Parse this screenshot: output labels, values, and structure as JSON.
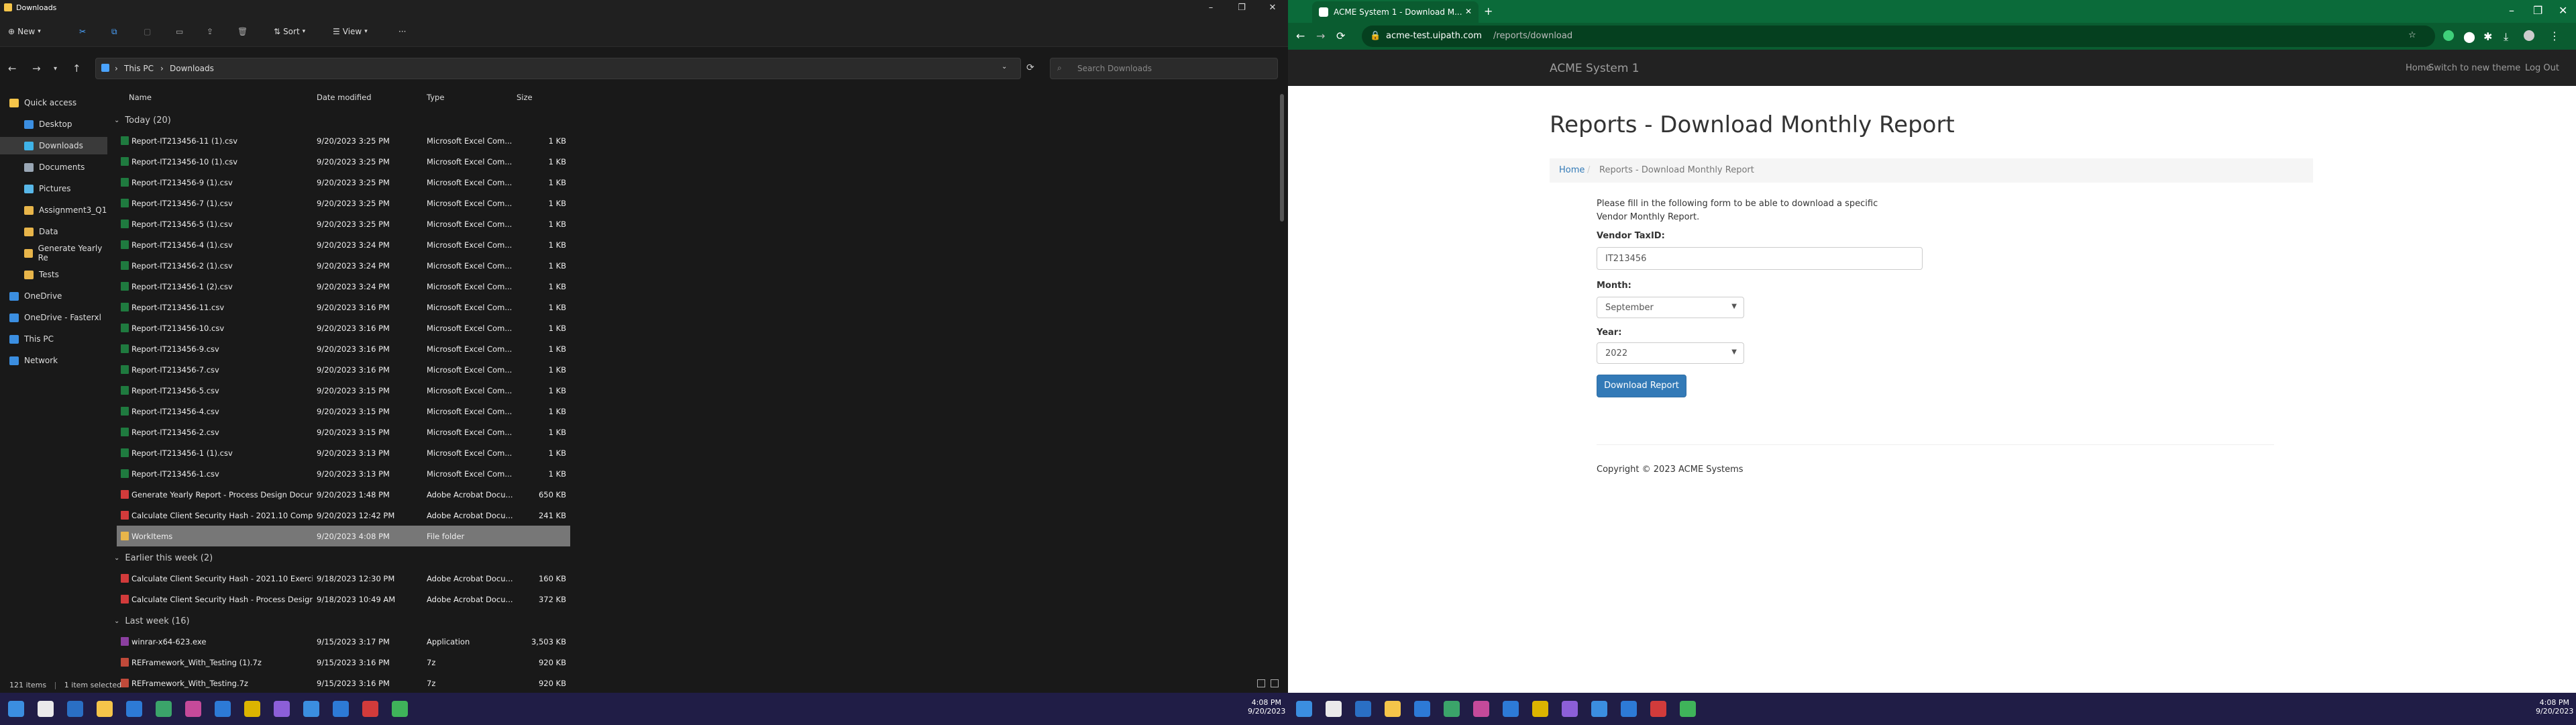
{
  "explorer": {
    "title": "Downloads",
    "cmd": {
      "new": "New",
      "sort": "Sort",
      "view": "View",
      "more": "···"
    },
    "address": {
      "root": "This PC",
      "folder": "Downloads"
    },
    "search_placeholder": "Search Downloads",
    "nav": [
      {
        "label": "Quick access",
        "color": "#f5c54a",
        "indent": 0
      },
      {
        "label": "Desktop",
        "color": "#3b8ee0",
        "indent": 1
      },
      {
        "label": "Downloads",
        "color": "#3fb3e8",
        "indent": 1,
        "selected": true
      },
      {
        "label": "Documents",
        "color": "#9aa7b5",
        "indent": 1
      },
      {
        "label": "Pictures",
        "color": "#58b7e8",
        "indent": 1
      },
      {
        "label": "Assignment3_Q1",
        "color": "#e8b54a",
        "indent": 1
      },
      {
        "label": "Data",
        "color": "#e8b54a",
        "indent": 1
      },
      {
        "label": "Generate Yearly Re",
        "color": "#e8b54a",
        "indent": 1
      },
      {
        "label": "Tests",
        "color": "#e8b54a",
        "indent": 1
      },
      {
        "label": "OneDrive",
        "color": "#3b8ee0",
        "indent": 0
      },
      {
        "label": "OneDrive - Fasterxl",
        "color": "#3b8ee0",
        "indent": 0
      },
      {
        "label": "This PC",
        "color": "#3b8ee0",
        "indent": 0
      },
      {
        "label": "Network",
        "color": "#3b8ee0",
        "indent": 0
      }
    ],
    "columns": {
      "name": "Name",
      "date": "Date modified",
      "type": "Type",
      "size": "Size"
    },
    "groups": [
      {
        "label": "Today (20)",
        "rows": [
          {
            "name": "Report-IT213456-11 (1).csv",
            "date": "9/20/2023 3:25 PM",
            "type": "Microsoft Excel Com...",
            "size": "1 KB",
            "icon": "#1f7a3f"
          },
          {
            "name": "Report-IT213456-10 (1).csv",
            "date": "9/20/2023 3:25 PM",
            "type": "Microsoft Excel Com...",
            "size": "1 KB",
            "icon": "#1f7a3f"
          },
          {
            "name": "Report-IT213456-9 (1).csv",
            "date": "9/20/2023 3:25 PM",
            "type": "Microsoft Excel Com...",
            "size": "1 KB",
            "icon": "#1f7a3f"
          },
          {
            "name": "Report-IT213456-7 (1).csv",
            "date": "9/20/2023 3:25 PM",
            "type": "Microsoft Excel Com...",
            "size": "1 KB",
            "icon": "#1f7a3f"
          },
          {
            "name": "Report-IT213456-5 (1).csv",
            "date": "9/20/2023 3:25 PM",
            "type": "Microsoft Excel Com...",
            "size": "1 KB",
            "icon": "#1f7a3f"
          },
          {
            "name": "Report-IT213456-4 (1).csv",
            "date": "9/20/2023 3:24 PM",
            "type": "Microsoft Excel Com...",
            "size": "1 KB",
            "icon": "#1f7a3f"
          },
          {
            "name": "Report-IT213456-2 (1).csv",
            "date": "9/20/2023 3:24 PM",
            "type": "Microsoft Excel Com...",
            "size": "1 KB",
            "icon": "#1f7a3f"
          },
          {
            "name": "Report-IT213456-1 (2).csv",
            "date": "9/20/2023 3:24 PM",
            "type": "Microsoft Excel Com...",
            "size": "1 KB",
            "icon": "#1f7a3f"
          },
          {
            "name": "Report-IT213456-11.csv",
            "date": "9/20/2023 3:16 PM",
            "type": "Microsoft Excel Com...",
            "size": "1 KB",
            "icon": "#1f7a3f"
          },
          {
            "name": "Report-IT213456-10.csv",
            "date": "9/20/2023 3:16 PM",
            "type": "Microsoft Excel Com...",
            "size": "1 KB",
            "icon": "#1f7a3f"
          },
          {
            "name": "Report-IT213456-9.csv",
            "date": "9/20/2023 3:16 PM",
            "type": "Microsoft Excel Com...",
            "size": "1 KB",
            "icon": "#1f7a3f"
          },
          {
            "name": "Report-IT213456-7.csv",
            "date": "9/20/2023 3:16 PM",
            "type": "Microsoft Excel Com...",
            "size": "1 KB",
            "icon": "#1f7a3f"
          },
          {
            "name": "Report-IT213456-5.csv",
            "date": "9/20/2023 3:15 PM",
            "type": "Microsoft Excel Com...",
            "size": "1 KB",
            "icon": "#1f7a3f"
          },
          {
            "name": "Report-IT213456-4.csv",
            "date": "9/20/2023 3:15 PM",
            "type": "Microsoft Excel Com...",
            "size": "1 KB",
            "icon": "#1f7a3f"
          },
          {
            "name": "Report-IT213456-2.csv",
            "date": "9/20/2023 3:15 PM",
            "type": "Microsoft Excel Com...",
            "size": "1 KB",
            "icon": "#1f7a3f"
          },
          {
            "name": "Report-IT213456-1 (1).csv",
            "date": "9/20/2023 3:13 PM",
            "type": "Microsoft Excel Com...",
            "size": "1 KB",
            "icon": "#1f7a3f"
          },
          {
            "name": "Report-IT213456-1.csv",
            "date": "9/20/2023 3:13 PM",
            "type": "Microsoft Excel Com...",
            "size": "1 KB",
            "icon": "#1f7a3f"
          },
          {
            "name": "Generate Yearly Report - Process Design Docum...",
            "date": "9/20/2023 1:48 PM",
            "type": "Adobe Acrobat Docu...",
            "size": "650 KB",
            "icon": "#d23b3b"
          },
          {
            "name": "Calculate Client Security Hash - 2021.10 Compl...",
            "date": "9/20/2023 12:42 PM",
            "type": "Adobe Acrobat Docu...",
            "size": "241 KB",
            "icon": "#d23b3b"
          },
          {
            "name": "WorkItems",
            "date": "9/20/2023 4:08 PM",
            "type": "File folder",
            "size": "",
            "icon": "#e8b54a",
            "selected": true
          }
        ]
      },
      {
        "label": "Earlier this week (2)",
        "rows": [
          {
            "name": "Calculate Client Security Hash - 2021.10 Exercis...",
            "date": "9/18/2023 12:30 PM",
            "type": "Adobe Acrobat Docu...",
            "size": "160 KB",
            "icon": "#d23b3b"
          },
          {
            "name": "Calculate Client Security Hash - Process Design ...",
            "date": "9/18/2023 10:49 AM",
            "type": "Adobe Acrobat Docu...",
            "size": "372 KB",
            "icon": "#d23b3b"
          }
        ]
      },
      {
        "label": "Last week (16)",
        "rows": [
          {
            "name": "winrar-x64-623.exe",
            "date": "9/15/2023 3:17 PM",
            "type": "Application",
            "size": "3,503 KB",
            "icon": "#8b3fa0"
          },
          {
            "name": "REFramework_With_Testing (1).7z",
            "date": "9/15/2023 3:16 PM",
            "type": "7z",
            "size": "920 KB",
            "icon": "#c04a3a"
          },
          {
            "name": "REFramework_With_Testing.7z",
            "date": "9/15/2023 3:16 PM",
            "type": "7z",
            "size": "920 KB",
            "icon": "#c04a3a"
          }
        ]
      }
    ],
    "status": {
      "items": "121 items",
      "selected": "1 item selected"
    },
    "clock": {
      "time": "4:08 PM",
      "date": "9/20/2023"
    }
  },
  "chrome": {
    "tab_title": "ACME System 1 - Download M...",
    "url_host": "acme-test.uipath.com",
    "url_path": "/reports/download",
    "clock": {
      "time": "4:08 PM",
      "date": "9/20/2023"
    }
  },
  "acme": {
    "brand": "ACME System 1",
    "nav": {
      "home": "Home",
      "theme": "Switch to new theme",
      "logout": "Log Out"
    },
    "heading": "Reports - Download Monthly Report",
    "breadcrumb": {
      "home": "Home",
      "current": "Reports - Download Monthly Report"
    },
    "intro": "Please fill in the following form to be able to download a specific Vendor Monthly Report.",
    "vendor_label": "Vendor TaxID:",
    "vendor_value": "IT213456",
    "month_label": "Month:",
    "month_value": "September",
    "year_label": "Year:",
    "year_value": "2022",
    "button": "Download Report",
    "copyright": "Copyright © 2023 ACME Systems"
  }
}
